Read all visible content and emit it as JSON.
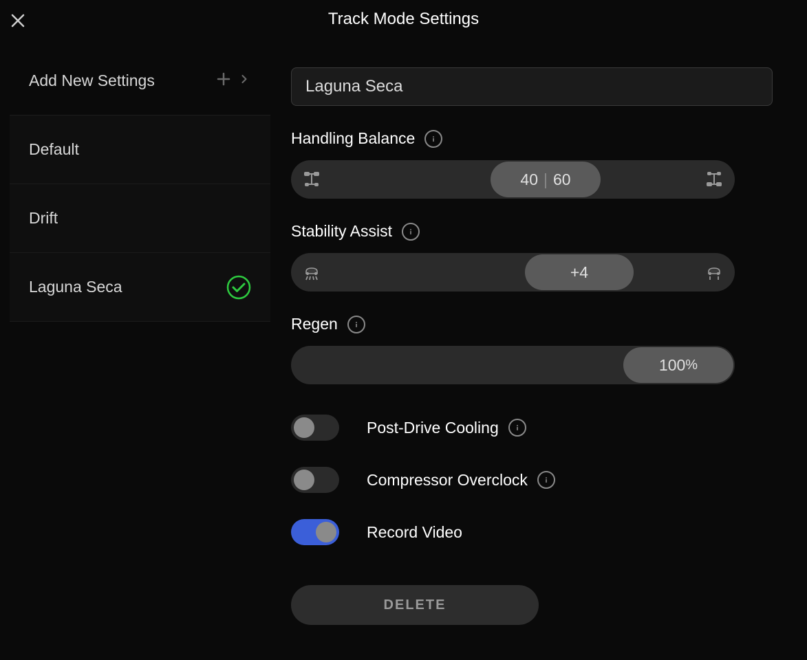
{
  "header": {
    "title": "Track Mode Settings"
  },
  "sidebar": {
    "add_new_label": "Add New Settings",
    "items": [
      {
        "label": "Default"
      },
      {
        "label": "Drift"
      },
      {
        "label": "Laguna Seca"
      }
    ]
  },
  "main": {
    "profile_name": "Laguna Seca",
    "handling_balance": {
      "label": "Handling Balance",
      "front": "40",
      "rear": "60"
    },
    "stability_assist": {
      "label": "Stability Assist",
      "value": "+4"
    },
    "regen": {
      "label": "Regen",
      "value": "100",
      "unit": "%"
    },
    "toggles": {
      "post_drive_cooling": {
        "label": "Post-Drive Cooling",
        "on": false
      },
      "compressor_overclock": {
        "label": "Compressor Overclock",
        "on": false
      },
      "record_video": {
        "label": "Record Video",
        "on": true
      }
    },
    "delete_label": "DELETE"
  }
}
